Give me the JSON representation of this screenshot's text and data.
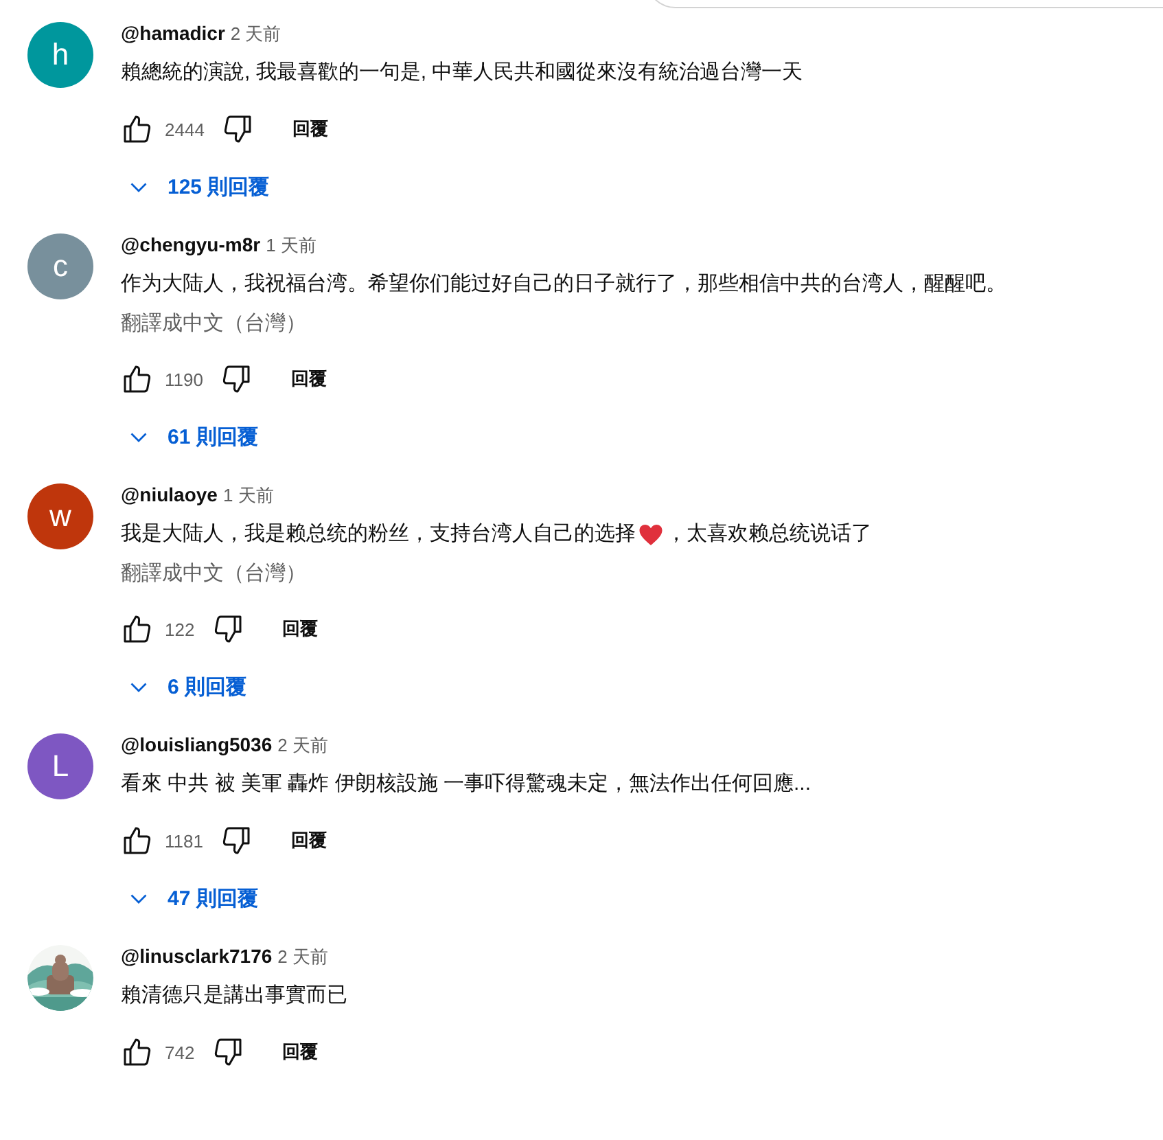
{
  "comments": [
    {
      "avatar": {
        "kind": "letter",
        "letter": "h",
        "color": "#00979d"
      },
      "author": "@hamadicr",
      "time": "2 天前",
      "segments": [
        {
          "kind": "text",
          "text": "賴總統的演說, 我最喜歡的一句是, 中華人民共和國從來沒有統治過台灣一天"
        }
      ],
      "likes": "2444",
      "reply": "回覆",
      "replies": "125 則回覆"
    },
    {
      "avatar": {
        "kind": "letter",
        "letter": "c",
        "color": "#78909c"
      },
      "author": "@chengyu-m8r",
      "time": "1 天前",
      "segments": [
        {
          "kind": "text",
          "text": "作为大陆人，我祝福台湾。希望你们能过好自己的日子就行了，那些相信中共的台湾人，醒醒吧。"
        }
      ],
      "translate": "翻譯成中文（台灣）",
      "likes": "1190",
      "reply": "回覆",
      "replies": "61 則回覆"
    },
    {
      "avatar": {
        "kind": "letter",
        "letter": "w",
        "color": "#bf360c"
      },
      "author": "@niulaoye",
      "time": "1 天前",
      "segments": [
        {
          "kind": "text",
          "text": "我是大陆人，我是赖总统的粉丝，支持台湾人自己的选择"
        },
        {
          "kind": "heart"
        },
        {
          "kind": "text",
          "text": "，太喜欢赖总统说话了"
        }
      ],
      "translate": "翻譯成中文（台灣）",
      "likes": "122",
      "reply": "回覆",
      "replies": "6 則回覆"
    },
    {
      "avatar": {
        "kind": "letter",
        "letter": "L",
        "color": "#7e57c2"
      },
      "author": "@louisliang5036",
      "time": "2 天前",
      "segments": [
        {
          "kind": "text",
          "text": "看來 中共 被 美軍 轟炸 伊朗核設施 一事吓得驚魂未定，無法作出任何回應..."
        }
      ],
      "likes": "1181",
      "reply": "回覆",
      "replies": "47 則回覆"
    },
    {
      "author": "@linusclark7176",
      "time": "2 天前",
      "segments": [
        {
          "kind": "text",
          "text": "賴清德只是講出事實而已"
        }
      ],
      "likes": "742",
      "reply": "回覆"
    }
  ]
}
